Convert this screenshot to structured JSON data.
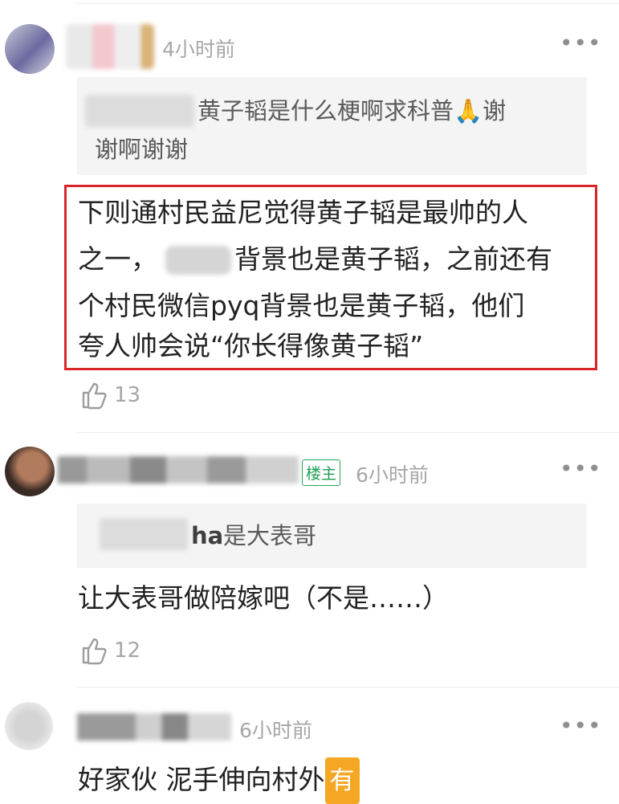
{
  "comment1": {
    "time": "4小时前",
    "quote": "黄子韬是什么梗啊求科普🙏谢谢啊谢谢",
    "quote_lines": [
      "黄子韬是什么梗啊求科普🙏谢",
      "谢啊谢谢"
    ],
    "body_lines": [
      "下则通村民益尼觉得黄子韬是最帅的人",
      "之一，",
      "背景也是黄子韬，之前还有",
      "个村民微信pyq背景也是黄子韬，他们",
      "夸人帅会说“你长得像黄子韬”"
    ],
    "likes": "13"
  },
  "comment2": {
    "tag": "楼主",
    "time": "6小时前",
    "quote_suffix": "ha",
    "quote_text": "是大表哥",
    "body": "让大表哥做陪嫁吧（不是……）",
    "likes": "12"
  },
  "comment3": {
    "time": "6小时前",
    "body": "好家伙 泥手伸向村外",
    "badge": "有"
  },
  "icons": {
    "more": "more-dots-icon",
    "like": "thumbs-up-icon"
  },
  "colors": {
    "highlight_border": "#d9262b",
    "op_tag": "#1f9c54",
    "badge": "#f5a623"
  }
}
